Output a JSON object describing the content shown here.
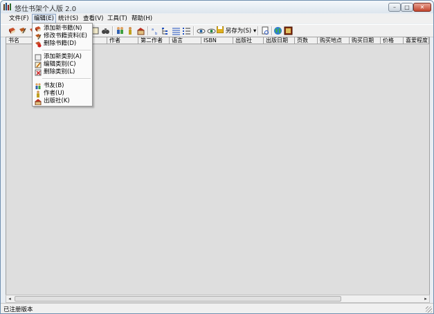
{
  "window": {
    "title": "悠仕书架个人版 2.0",
    "min_glyph": "–",
    "max_glyph": "□",
    "close_glyph": "✕"
  },
  "menu": [
    "文件(F)",
    "编辑(E)",
    "统计(S)",
    "查看(V)",
    "工具(T)",
    "帮助(H)"
  ],
  "toolbar": {
    "saveas_label": "另存为(S)",
    "saveas_arrow": "▾"
  },
  "columns": [
    "书名",
    "作者",
    "第二作者",
    "语言",
    "ISBN",
    "出版社",
    "出版日期",
    "页数",
    "购买地点",
    "购买日期",
    "价格",
    "喜爱程度"
  ],
  "edit_menu": [
    {
      "label": "添加新书籍(N)",
      "icon": "book-add-icon"
    },
    {
      "label": "修改书籍资料(E)",
      "icon": "book-edit-icon"
    },
    {
      "label": "删除书籍(D)",
      "icon": "book-delete-icon"
    },
    {
      "label": "添加新类别(A)",
      "icon": "category-add-icon"
    },
    {
      "label": "编辑类别(C)",
      "icon": "category-edit-icon"
    },
    {
      "label": "删除类别(L)",
      "icon": "category-delete-icon"
    },
    {
      "label": "书友(B)",
      "icon": "friends-icon"
    },
    {
      "label": "作者(U)",
      "icon": "author-icon"
    },
    {
      "label": "出版社(K)",
      "icon": "publisher-icon"
    }
  ],
  "scrollbar": {
    "left_arrow": "◂",
    "right_arrow": "▸"
  },
  "status": {
    "text": "已注册版本"
  }
}
